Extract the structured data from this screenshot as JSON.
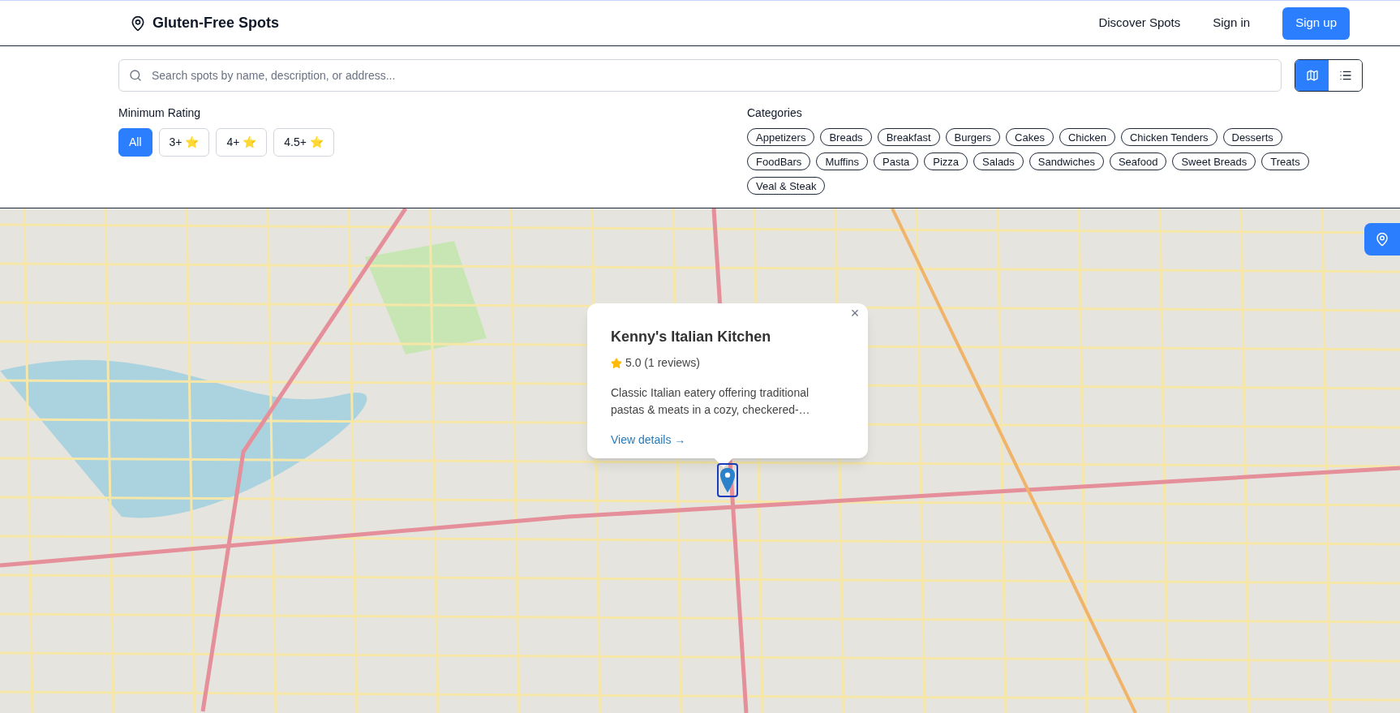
{
  "header": {
    "brand": "Gluten-Free Spots",
    "nav": [
      "Discover Spots",
      "Sign in"
    ],
    "signup": "Sign up"
  },
  "search": {
    "placeholder": "Search spots by name, description, or address..."
  },
  "view_toggle": [
    {
      "kind": "map",
      "selected": true
    },
    {
      "kind": "list",
      "selected": false
    }
  ],
  "rating_filter": {
    "label": "Minimum Rating",
    "options": [
      {
        "label": "All",
        "selected": true
      },
      {
        "label": "3+ ⭐",
        "selected": false
      },
      {
        "label": "4+ ⭐",
        "selected": false
      },
      {
        "label": "4.5+ ⭐",
        "selected": false
      }
    ]
  },
  "categories": {
    "label": "Categories",
    "items": [
      {
        "label": "Appetizers",
        "selected": false
      },
      {
        "label": "Breads",
        "selected": false
      },
      {
        "label": "Breakfast",
        "selected": false
      },
      {
        "label": "Burgers",
        "selected": false
      },
      {
        "label": "Cakes",
        "selected": false
      },
      {
        "label": "Chicken",
        "selected": false
      },
      {
        "label": "Chicken Tenders",
        "selected": false
      },
      {
        "label": "Desserts",
        "selected": false
      },
      {
        "label": "FoodBars",
        "selected": false
      },
      {
        "label": "Muffins",
        "selected": false
      },
      {
        "label": "Pasta",
        "selected": false
      },
      {
        "label": "Pizza",
        "selected": false
      },
      {
        "label": "Salads",
        "selected": false
      },
      {
        "label": "Sandwiches",
        "selected": false
      },
      {
        "label": "Seafood",
        "selected": false
      },
      {
        "label": "Sweet Breads",
        "selected": false
      },
      {
        "label": "Treats",
        "selected": false
      },
      {
        "label": "Veal & Steak",
        "selected": false
      }
    ]
  },
  "popup": {
    "title": "Kenny's Italian Kitchen",
    "rating": "5.0 (1 reviews)",
    "description": "Classic Italian eatery offering traditional pastas & meats in a cozy, checkered-…",
    "link": "View details →",
    "close": "×"
  }
}
